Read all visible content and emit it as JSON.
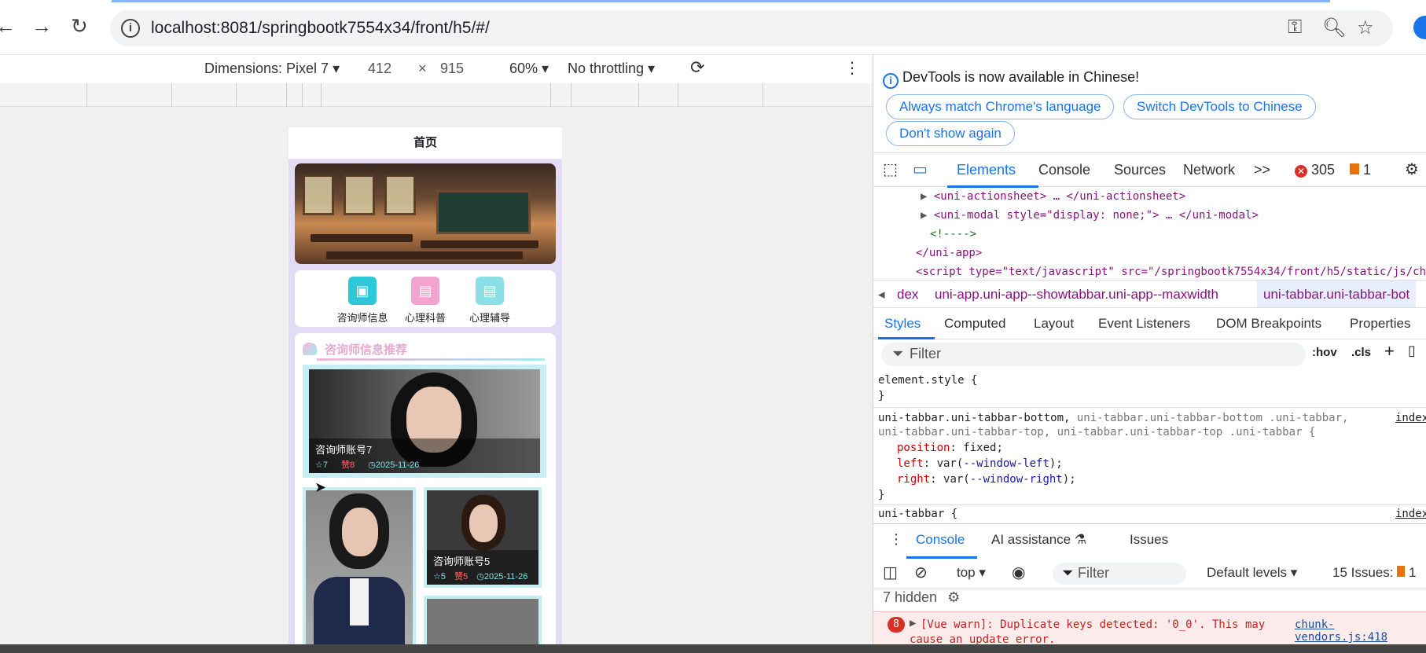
{
  "browser": {
    "url": "localhost:8081/springbootk7554x34/front/h5/#/"
  },
  "device_toolbar": {
    "dimensions": "Dimensions: Pixel 7 ▾",
    "width": "412",
    "times": "×",
    "height": "915",
    "zoom": "60% ▾",
    "throttling": "No throttling ▾"
  },
  "app": {
    "title": "首页",
    "menu": [
      {
        "label": "咨询师信息",
        "color": "#2ec6d9"
      },
      {
        "label": "心理科普",
        "color": "#f3a3cf"
      },
      {
        "label": "心理辅导",
        "color": "#8ae0e6"
      }
    ],
    "section_title": "咨询师信息推荐",
    "cards": [
      {
        "name": "咨询师账号7",
        "views": "7",
        "likes": "8",
        "date": "2025-11-26"
      },
      {
        "name": "",
        "views": "",
        "likes": "",
        "date": ""
      },
      {
        "name": "咨询师账号5",
        "views": "5",
        "likes": "5",
        "date": "2025-11-26"
      }
    ]
  },
  "devtools": {
    "notice": "DevTools is now available in Chinese!",
    "btn_match": "Always match Chrome's language",
    "btn_switch": "Switch DevTools to Chinese",
    "btn_dont": "Don't show again",
    "tabs": [
      "Elements",
      "Console",
      "Sources",
      "Network"
    ],
    "more": ">>",
    "errors": "305",
    "warnings": "1",
    "dom_lines": [
      "<uni-actionsheet> … </uni-actionsheet>",
      "<uni-modal style=\"display: none;\"> … </uni-modal>",
      "<!---->",
      "</uni-app>",
      "<script type=\"text/javascript\" src=\"/springbootk7554x34/front/h5/static/js/ch"
    ],
    "crumbs": [
      "dex",
      "uni-app.uni-app--showtabbar.uni-app--maxwidth",
      "uni-tabbar.uni-tabbar-bot"
    ],
    "subtabs": [
      "Styles",
      "Computed",
      "Layout",
      "Event Listeners",
      "DOM Breakpoints",
      "Properties"
    ],
    "filter_placeholder": "Filter",
    "hov": ":hov",
    "cls": ".cls",
    "css": {
      "l1": "element.style {",
      "l2": "}",
      "sel_a": "uni-tabbar.uni-tabbar-bottom,",
      "sel_b": " uni-tabbar.uni-tabbar-bottom .uni-tabbar,",
      "sel_c": "uni-tabbar.uni-tabbar-top, uni-tabbar.uni-tabbar-top .uni-tabbar {",
      "source": "index",
      "p1": "position",
      "v1": "fixed;",
      "p2": "left",
      "v2a": "var(",
      "v2b": "--window-left",
      "v2c": ");",
      "p3": "right",
      "v3a": "var(",
      "v3b": "--window-right",
      "v3c": ");",
      "close": "}",
      "partial": "uni-tabbar {",
      "partial_src": "index"
    },
    "drawer_tabs": [
      "Console",
      "AI assistance",
      "Issues"
    ],
    "console_context": "top ▾",
    "console_filter": "Filter",
    "levels": "Default levels ▾",
    "issues": "15 Issues:",
    "issues_count": "1",
    "hidden": "7 hidden",
    "error_count": "8",
    "error_text": "[Vue warn]: Duplicate keys detected: '0_0'. This may",
    "error_text2": "cause an update error.",
    "error_src": "chunk-vendors.js:418"
  }
}
